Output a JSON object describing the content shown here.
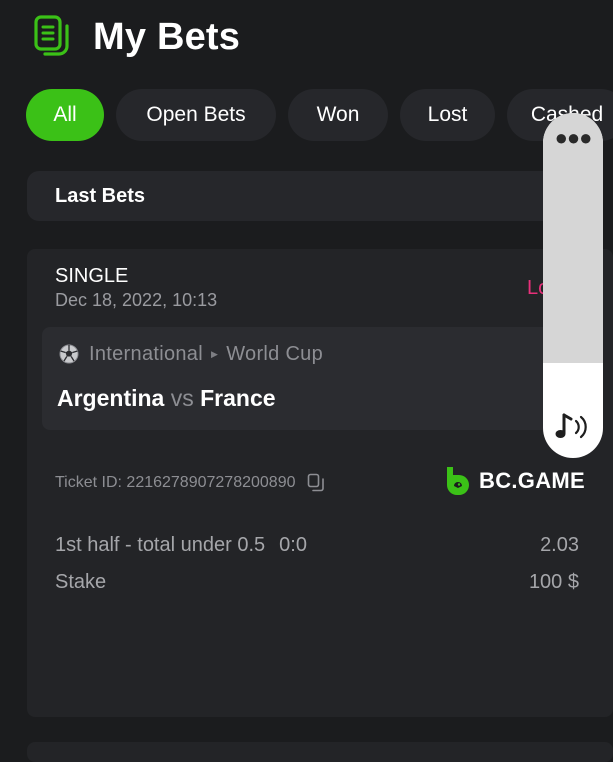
{
  "header": {
    "title": "My Bets",
    "icon": "bets-list-icon",
    "accent_color": "#3bc117"
  },
  "tabs": [
    {
      "label": "All",
      "active": true
    },
    {
      "label": "Open Bets",
      "active": false
    },
    {
      "label": "Won",
      "active": false
    },
    {
      "label": "Lost",
      "active": false
    },
    {
      "label": "Cashed",
      "active": false
    }
  ],
  "section": {
    "title": "Last Bets"
  },
  "bet": {
    "type": "SINGLE",
    "date": "Dec 18, 2022, 10:13",
    "status": "Lost",
    "status_color": "#e8307a",
    "event": {
      "category": "International",
      "league": "World Cup",
      "home": "Argentina",
      "vs": "vs",
      "away": "France"
    },
    "ticket_label": "Ticket ID: 2216278907278200890",
    "brand": "BC.GAME",
    "market": "1st half - total under 0.5",
    "score": "0:0",
    "odds": "2.03",
    "stake_label": "Stake",
    "stake_value": "100 $"
  },
  "overlay": {
    "menu_icon": "more-dots-icon",
    "volume_icon": "volume-icon"
  }
}
